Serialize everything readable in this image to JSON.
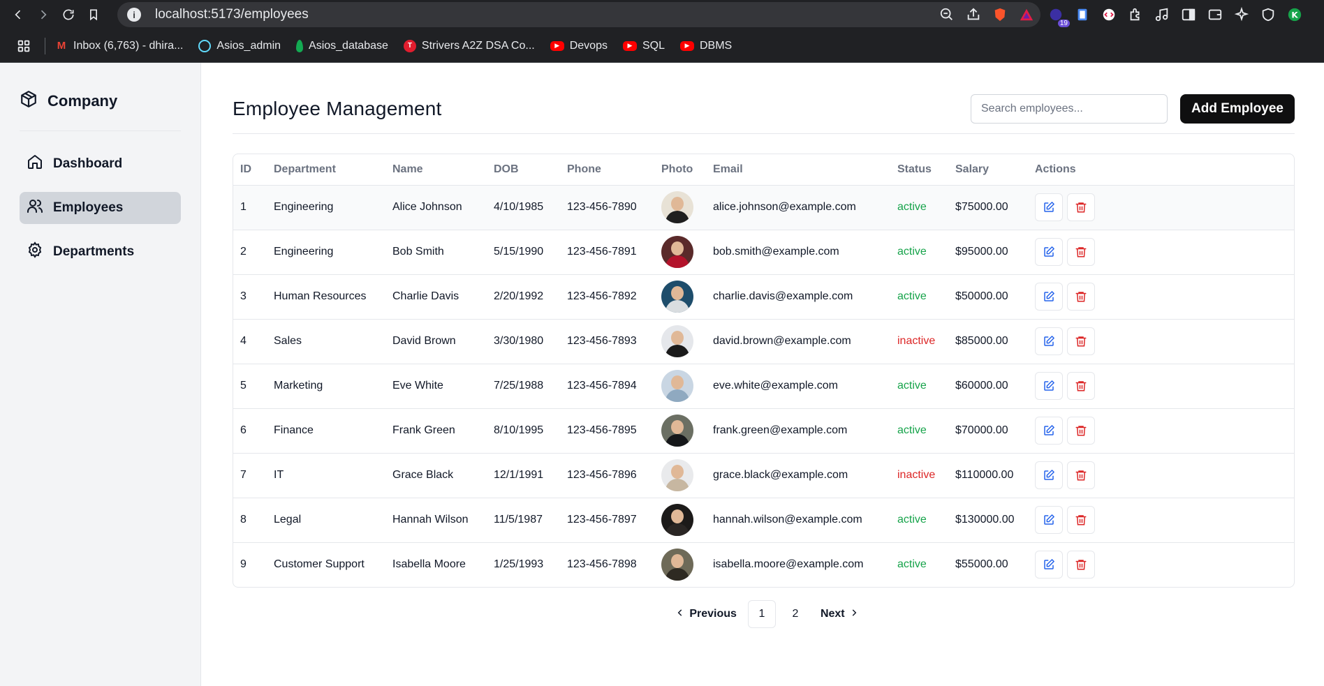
{
  "browser": {
    "url": "localhost:5173/employees",
    "extension_badge": "19",
    "bookmarks": [
      {
        "label": "Inbox (6,763) - dhira...",
        "icon": "gmail-icon",
        "color": "#ea4335"
      },
      {
        "label": "Asios_admin",
        "icon": "react-icon",
        "color": "#61dafb"
      },
      {
        "label": "Asios_database",
        "icon": "mongodb-icon",
        "color": "#13aa52"
      },
      {
        "label": "Strivers A2Z DSA Co...",
        "icon": "tuf-icon",
        "color": "#e11d2e"
      },
      {
        "label": "Devops",
        "icon": "youtube-icon",
        "color": "#ff0000"
      },
      {
        "label": "SQL",
        "icon": "youtube-icon",
        "color": "#ff0000"
      },
      {
        "label": "DBMS",
        "icon": "youtube-icon",
        "color": "#ff0000"
      }
    ]
  },
  "sidebar": {
    "brand": "Company",
    "items": [
      {
        "label": "Dashboard",
        "icon": "home-icon",
        "active": false
      },
      {
        "label": "Employees",
        "icon": "users-icon",
        "active": true
      },
      {
        "label": "Departments",
        "icon": "gear-icon",
        "active": false
      }
    ]
  },
  "header": {
    "title": "Employee Management",
    "search_placeholder": "Search employees...",
    "add_label": "Add Employee"
  },
  "table": {
    "columns": [
      "ID",
      "Department",
      "Name",
      "DOB",
      "Phone",
      "Photo",
      "Email",
      "Status",
      "Salary",
      "Actions"
    ],
    "rows": [
      {
        "id": "1",
        "department": "Engineering",
        "name": "Alice Johnson",
        "dob": "4/10/1985",
        "phone": "123-456-7890",
        "email": "alice.johnson@example.com",
        "status": "active",
        "salary": "$75000.00",
        "photo_bg": "#e8e2d6",
        "photo_fg": "#1f1f1f"
      },
      {
        "id": "2",
        "department": "Engineering",
        "name": "Bob Smith",
        "dob": "5/15/1990",
        "phone": "123-456-7891",
        "email": "bob.smith@example.com",
        "status": "active",
        "salary": "$95000.00",
        "photo_bg": "#5a2a2a",
        "photo_fg": "#b3132b"
      },
      {
        "id": "3",
        "department": "Human Resources",
        "name": "Charlie Davis",
        "dob": "2/20/1992",
        "phone": "123-456-7892",
        "email": "charlie.davis@example.com",
        "status": "active",
        "salary": "$50000.00",
        "photo_bg": "#1e4d6b",
        "photo_fg": "#d9dde0"
      },
      {
        "id": "4",
        "department": "Sales",
        "name": "David Brown",
        "dob": "3/30/1980",
        "phone": "123-456-7893",
        "email": "david.brown@example.com",
        "status": "inactive",
        "salary": "$85000.00",
        "photo_bg": "#e5e7eb",
        "photo_fg": "#1a1a1a"
      },
      {
        "id": "5",
        "department": "Marketing",
        "name": "Eve White",
        "dob": "7/25/1988",
        "phone": "123-456-7894",
        "email": "eve.white@example.com",
        "status": "active",
        "salary": "$60000.00",
        "photo_bg": "#c9d6e3",
        "photo_fg": "#8fa9c0"
      },
      {
        "id": "6",
        "department": "Finance",
        "name": "Frank Green",
        "dob": "8/10/1995",
        "phone": "123-456-7895",
        "email": "frank.green@example.com",
        "status": "active",
        "salary": "$70000.00",
        "photo_bg": "#6b6f63",
        "photo_fg": "#15171a"
      },
      {
        "id": "7",
        "department": "IT",
        "name": "Grace Black",
        "dob": "12/1/1991",
        "phone": "123-456-7896",
        "email": "grace.black@example.com",
        "status": "inactive",
        "salary": "$110000.00",
        "photo_bg": "#e9eaec",
        "photo_fg": "#c7b7a1"
      },
      {
        "id": "8",
        "department": "Legal",
        "name": "Hannah Wilson",
        "dob": "11/5/1987",
        "phone": "123-456-7897",
        "email": "hannah.wilson@example.com",
        "status": "active",
        "salary": "$130000.00",
        "photo_bg": "#1c1a19",
        "photo_fg": "#2a2624"
      },
      {
        "id": "9",
        "department": "Customer Support",
        "name": "Isabella Moore",
        "dob": "1/25/1993",
        "phone": "123-456-7898",
        "email": "isabella.moore@example.com",
        "status": "active",
        "salary": "$55000.00",
        "photo_bg": "#6e6a58",
        "photo_fg": "#2e2a22"
      }
    ]
  },
  "pagination": {
    "previous": "Previous",
    "pages": [
      "1",
      "2"
    ],
    "current": "1",
    "next": "Next"
  },
  "colors": {
    "active": "#16a34a",
    "inactive": "#dc2626",
    "edit": "#2563eb",
    "delete": "#dc2626"
  }
}
